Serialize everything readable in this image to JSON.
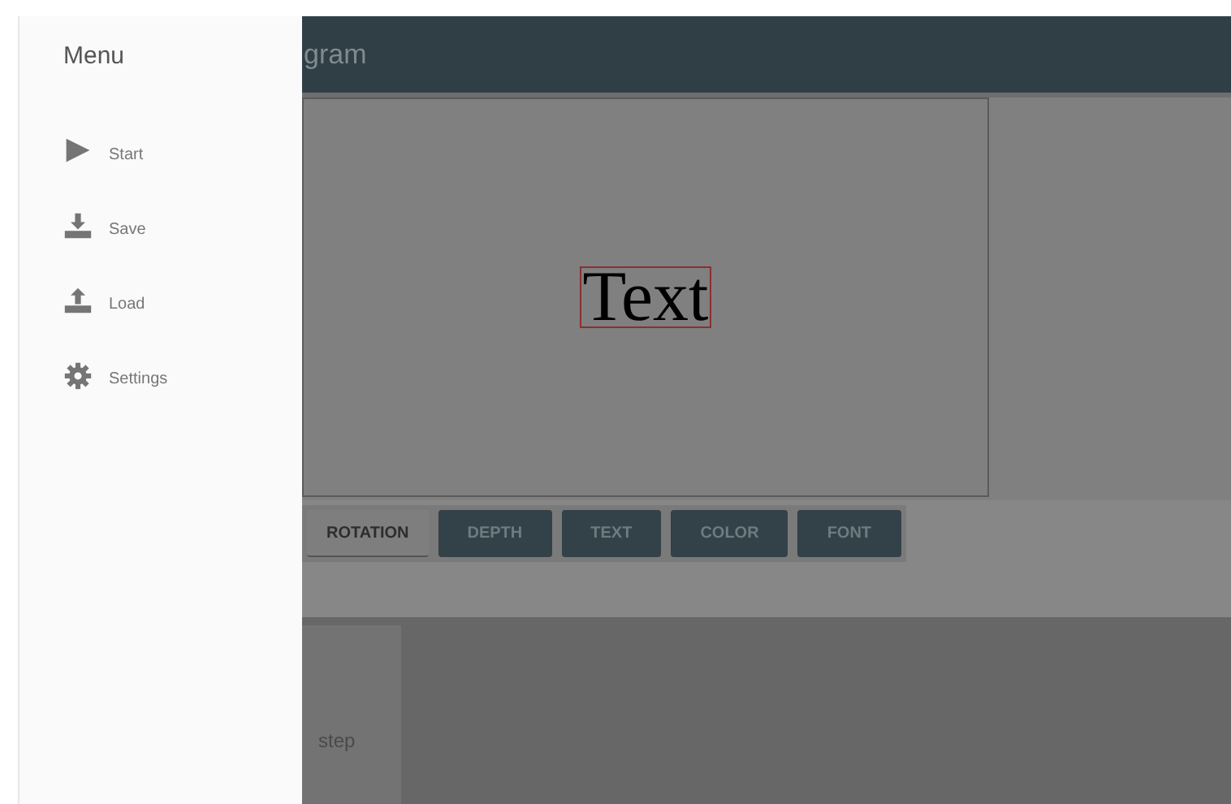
{
  "app_bar": {
    "title": "gram"
  },
  "canvas": {
    "text": "Text"
  },
  "tabs": [
    {
      "label": "ROTATION",
      "selected": true
    },
    {
      "label": "DEPTH",
      "selected": false
    },
    {
      "label": "TEXT",
      "selected": false
    },
    {
      "label": "COLOR",
      "selected": false
    },
    {
      "label": "FONT",
      "selected": false
    }
  ],
  "card": {
    "text": "step"
  },
  "drawer": {
    "title": "Menu",
    "items": [
      {
        "label": "Start"
      },
      {
        "label": "Save"
      },
      {
        "label": "Load"
      },
      {
        "label": "Settings"
      }
    ]
  }
}
